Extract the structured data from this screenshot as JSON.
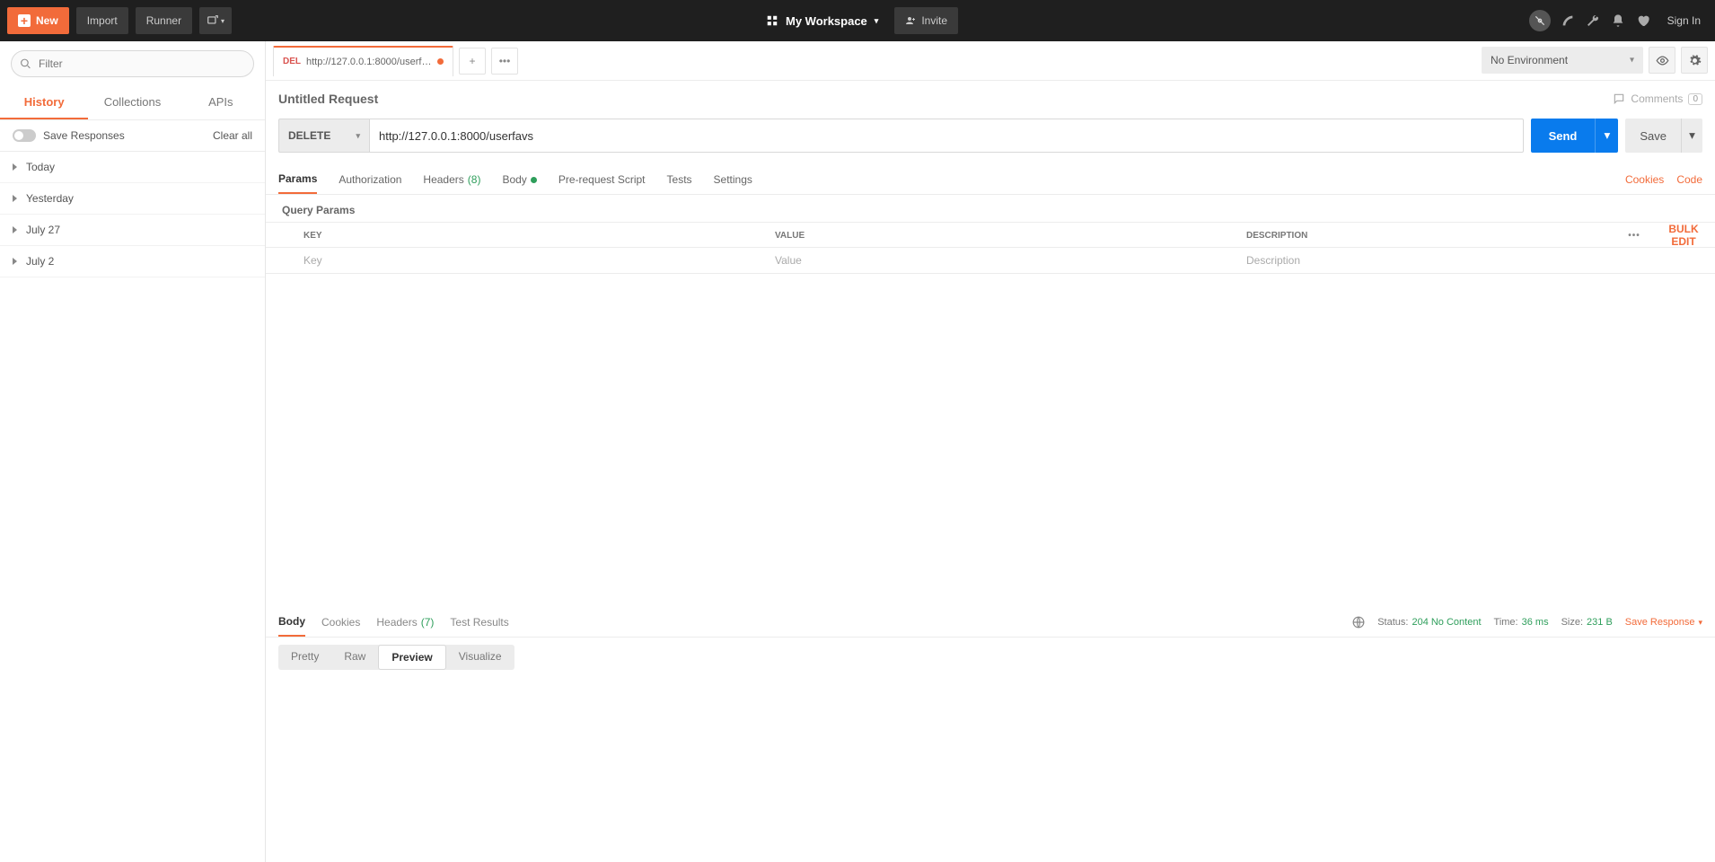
{
  "topbar": {
    "new_label": "New",
    "import_label": "Import",
    "runner_label": "Runner",
    "workspace_label": "My Workspace",
    "invite_label": "Invite",
    "signin_label": "Sign In"
  },
  "sidebar": {
    "filter_placeholder": "Filter",
    "tabs": {
      "history": "History",
      "collections": "Collections",
      "apis": "APIs"
    },
    "save_responses_label": "Save Responses",
    "clear_all_label": "Clear all",
    "history_items": [
      "Today",
      "Yesterday",
      "July 27",
      "July 2"
    ]
  },
  "request": {
    "tab_method_short": "DEL",
    "tab_url": "http://127.0.0.1:8000/userfavs",
    "title": "Untitled Request",
    "comments_label": "Comments",
    "comments_count": "0",
    "method": "DELETE",
    "url": "http://127.0.0.1:8000/userfavs",
    "send_label": "Send",
    "save_label": "Save",
    "tabs": {
      "params": "Params",
      "auth": "Authorization",
      "headers": "Headers",
      "headers_count": "(8)",
      "body": "Body",
      "prerequest": "Pre-request Script",
      "tests": "Tests",
      "settings": "Settings"
    },
    "cookies_link": "Cookies",
    "code_link": "Code",
    "query_params_label": "Query Params",
    "table": {
      "key_header": "KEY",
      "value_header": "VALUE",
      "desc_header": "DESCRIPTION",
      "bulk_edit": "Bulk Edit",
      "key_placeholder": "Key",
      "value_placeholder": "Value",
      "desc_placeholder": "Description"
    }
  },
  "environment": {
    "selected": "No Environment"
  },
  "response": {
    "tabs": {
      "body": "Body",
      "cookies": "Cookies",
      "headers": "Headers",
      "headers_count": "(7)",
      "tests": "Test Results"
    },
    "status_label": "Status:",
    "status_value": "204 No Content",
    "time_label": "Time:",
    "time_value": "36 ms",
    "size_label": "Size:",
    "size_value": "231 B",
    "save_response_label": "Save Response",
    "view_tabs": {
      "pretty": "Pretty",
      "raw": "Raw",
      "preview": "Preview",
      "visualize": "Visualize"
    }
  }
}
